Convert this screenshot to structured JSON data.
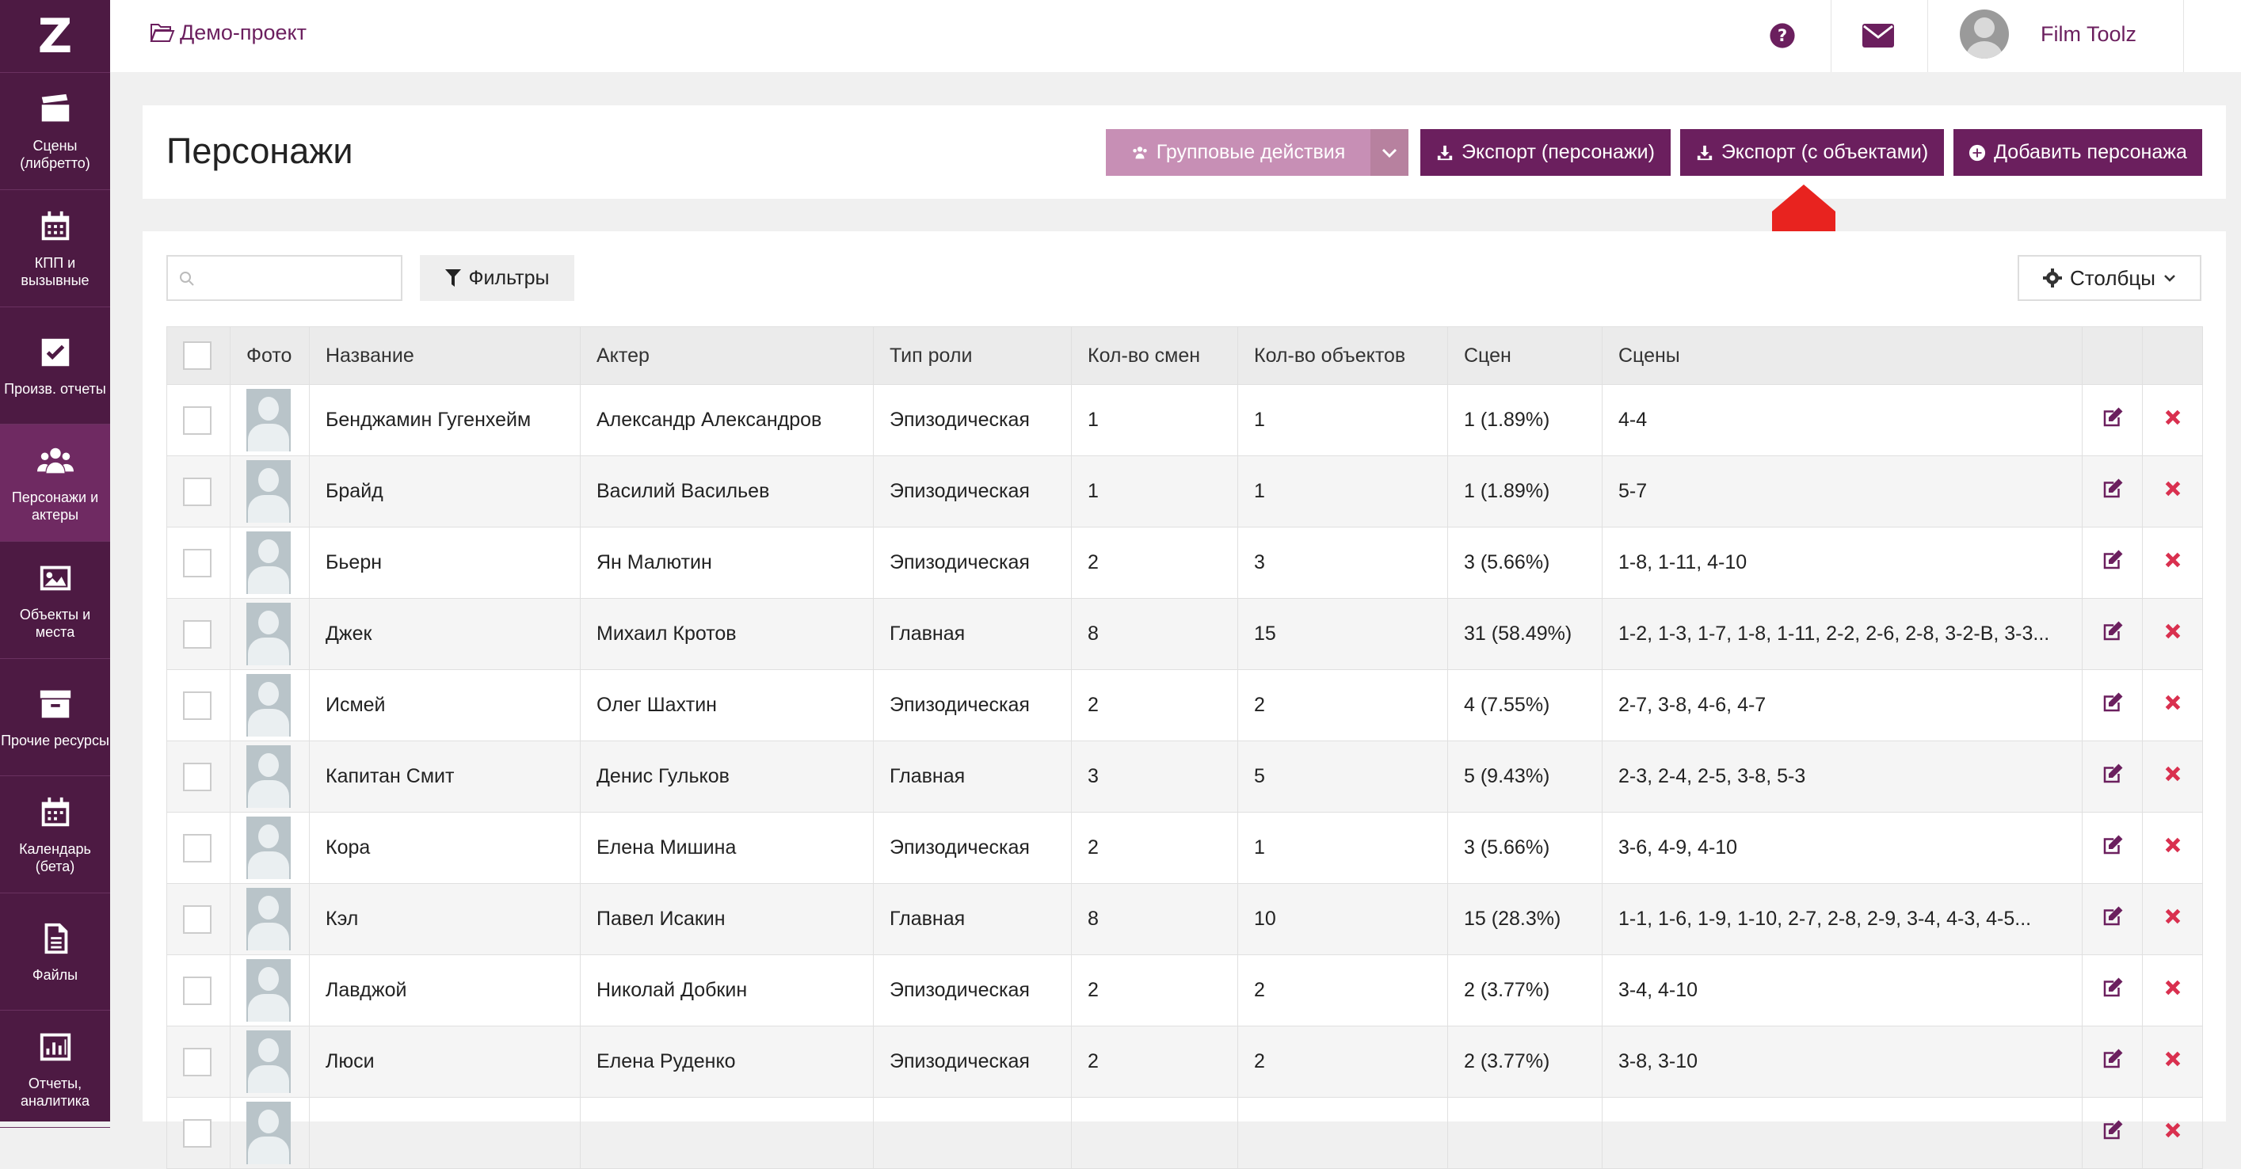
{
  "app": {
    "logo_letter": "Z",
    "project_name": "Демо-проект",
    "user_name": "Film Toolz",
    "language": "RU"
  },
  "sidebar": {
    "items": [
      {
        "label": "Сцены (либретто)",
        "icon": "clapperboard-icon"
      },
      {
        "label": "КПП и вызывные",
        "icon": "calendar-grid-icon"
      },
      {
        "label": "Произв. отчеты",
        "icon": "checkbox-icon"
      },
      {
        "label": "Персонажи и актеры",
        "icon": "people-icon",
        "active": true
      },
      {
        "label": "Объекты и места",
        "icon": "image-icon"
      },
      {
        "label": "Прочие ресурсы",
        "icon": "archive-box-icon"
      },
      {
        "label": "Календарь (бета)",
        "icon": "calendar-icon"
      },
      {
        "label": "Файлы",
        "icon": "file-icon"
      },
      {
        "label": "Отчеты, аналитика",
        "icon": "bar-chart-icon"
      }
    ]
  },
  "header": {
    "title": "Персонажи",
    "group_actions": "Групповые действия",
    "export_characters": "Экспорт (персонажи)",
    "export_with_objects": "Экспорт (с объектами)",
    "add_character": "Добавить персонажа"
  },
  "toolbar": {
    "search_placeholder": "",
    "filters_label": "Фильтры",
    "columns_label": "Столбцы"
  },
  "colors": {
    "accent": "#6b1f5e",
    "sidebar_bg": "#4d1a43",
    "delete": "#d9304f",
    "arrow": "#e8231f"
  },
  "table": {
    "columns": [
      "Фото",
      "Название",
      "Актер",
      "Тип роли",
      "Кол-во смен",
      "Кол-во объектов",
      "Сцен",
      "Сцены"
    ],
    "rows": [
      {
        "name": "Бенджамин Гугенхейм",
        "actor": "Александр Александров",
        "role": "Эпизодическая",
        "shifts": "1",
        "objects": "1",
        "scenes_count": "1 (1.89%)",
        "scenes": "4-4"
      },
      {
        "name": "Брайд",
        "actor": "Василий Васильев",
        "role": "Эпизодическая",
        "shifts": "1",
        "objects": "1",
        "scenes_count": "1 (1.89%)",
        "scenes": "5-7"
      },
      {
        "name": "Бьерн",
        "actor": "Ян Малютин",
        "role": "Эпизодическая",
        "shifts": "2",
        "objects": "3",
        "scenes_count": "3 (5.66%)",
        "scenes": "1-8, 1-11, 4-10"
      },
      {
        "name": "Джек",
        "actor": "Михаил Кротов",
        "role": "Главная",
        "shifts": "8",
        "objects": "15",
        "scenes_count": "31 (58.49%)",
        "scenes": "1-2, 1-3, 1-7, 1-8, 1-11, 2-2, 2-6, 2-8, 3-2-В, 3-3..."
      },
      {
        "name": "Исмей",
        "actor": "Олег Шахтин",
        "role": "Эпизодическая",
        "shifts": "2",
        "objects": "2",
        "scenes_count": "4 (7.55%)",
        "scenes": "2-7, 3-8, 4-6, 4-7"
      },
      {
        "name": "Капитан Смит",
        "actor": "Денис Гульков",
        "role": "Главная",
        "shifts": "3",
        "objects": "5",
        "scenes_count": "5 (9.43%)",
        "scenes": "2-3, 2-4, 2-5, 3-8, 5-3"
      },
      {
        "name": "Кора",
        "actor": "Елена Мишина",
        "role": "Эпизодическая",
        "shifts": "2",
        "objects": "1",
        "scenes_count": "3 (5.66%)",
        "scenes": "3-6, 4-9, 4-10"
      },
      {
        "name": "Кэл",
        "actor": "Павел Исакин",
        "role": "Главная",
        "shifts": "8",
        "objects": "10",
        "scenes_count": "15 (28.3%)",
        "scenes": "1-1, 1-6, 1-9, 1-10, 2-7, 2-8, 2-9, 3-4, 4-3, 4-5..."
      },
      {
        "name": "Лавджой",
        "actor": "Николай Добкин",
        "role": "Эпизодическая",
        "shifts": "2",
        "objects": "2",
        "scenes_count": "2 (3.77%)",
        "scenes": "3-4, 4-10"
      },
      {
        "name": "Люси",
        "actor": "Елена Руденко",
        "role": "Эпизодическая",
        "shifts": "2",
        "objects": "2",
        "scenes_count": "2 (3.77%)",
        "scenes": "3-8, 3-10"
      },
      {
        "name": "",
        "actor": "",
        "role": "",
        "shifts": "",
        "objects": "",
        "scenes_count": "",
        "scenes": ""
      }
    ]
  }
}
